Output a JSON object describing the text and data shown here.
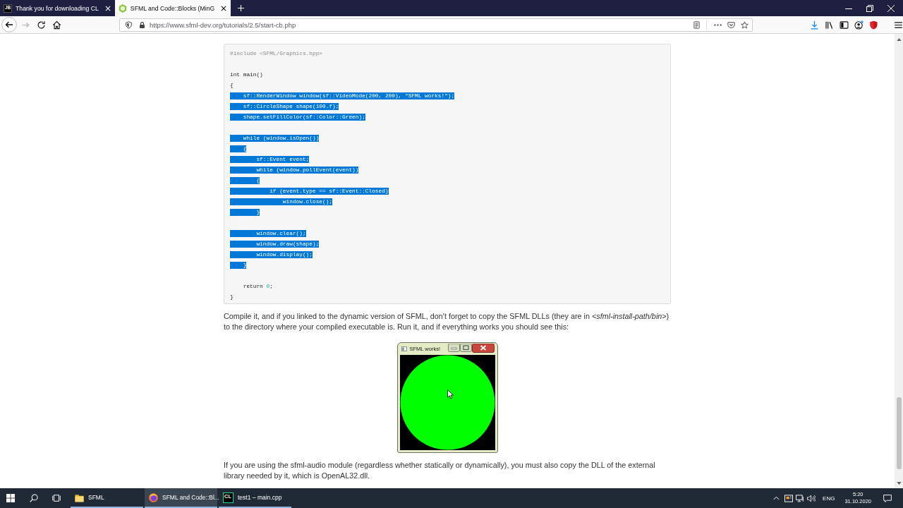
{
  "browser": {
    "tabs": [
      {
        "kind": "letter-logo",
        "icon_text": "JB",
        "title": "Thank you for downloading CL",
        "selected": false
      },
      {
        "kind": "sfml-logo",
        "title": "SFML and Code::Blocks (MinG",
        "selected": true
      }
    ],
    "navigation": {
      "forward_disabled": true
    },
    "url": "https://www.sfml-dev.org/tutorials/2.5/start-cb.php"
  },
  "page": {
    "blocks": [
      {
        "kind": "code",
        "lines": [
          {
            "kind": "directive",
            "text": "#include <SFML/Graphics.hpp>",
            "selected": false
          },
          {
            "kind": "blank"
          },
          {
            "kind": "code",
            "text": "int main()",
            "selected": false
          },
          {
            "kind": "code",
            "text": "{",
            "selected": false
          },
          {
            "kind": "code",
            "text": "    sf::RenderWindow window(sf::VideoMode(200, 200), \"SFML works!\");",
            "selected": true
          },
          {
            "kind": "code",
            "text": "    sf::CircleShape shape(100.f);",
            "selected": true
          },
          {
            "kind": "code",
            "text": "    shape.setFillColor(sf::Color::Green);",
            "selected": true
          },
          {
            "kind": "blank"
          },
          {
            "kind": "code",
            "text": "    while (window.isOpen())",
            "selected": true
          },
          {
            "kind": "code",
            "text": "    {",
            "selected": true
          },
          {
            "kind": "code",
            "text": "        sf::Event event;",
            "selected": true
          },
          {
            "kind": "code",
            "text": "        while (window.pollEvent(event))",
            "selected": true
          },
          {
            "kind": "code",
            "text": "        {",
            "selected": true
          },
          {
            "kind": "code",
            "text": "            if (event.type == sf::Event::Closed)",
            "selected": true
          },
          {
            "kind": "code",
            "text": "                window.close();",
            "selected": true
          },
          {
            "kind": "code",
            "text": "        }",
            "selected": true
          },
          {
            "kind": "blank"
          },
          {
            "kind": "code",
            "text": "        window.clear();",
            "selected": true
          },
          {
            "kind": "code",
            "text": "        window.draw(shape);",
            "selected": true
          },
          {
            "kind": "code",
            "text": "        window.display();",
            "selected": true
          },
          {
            "kind": "code",
            "text": "    }",
            "selected": true
          },
          {
            "kind": "blank"
          },
          {
            "kind": "code",
            "selected": false,
            "segments": [
              {
                "kind": "plain",
                "text": "    return "
              },
              {
                "kind": "number",
                "text": "0"
              },
              {
                "kind": "plain",
                "text": ";"
              }
            ]
          },
          {
            "kind": "code",
            "text": "}",
            "selected": false
          }
        ]
      },
      {
        "kind": "paragraph",
        "text": "Compile it, and if you linked to the dynamic version of SFML, don't forget to copy the SFML DLLs (they are in *<sfml-install-path/bin>*) to the directory where your compiled executable is. Run it, and if everything works you should see this:"
      },
      {
        "kind": "figure",
        "window_title": "SFML works!"
      },
      {
        "kind": "paragraph",
        "text": "If you are using the sfml-audio module (regardless whether statically or dynamically), you must also copy the DLL of the external library needed by it, which is OpenAL32.dll."
      }
    ]
  },
  "taskbar": {
    "items": [
      {
        "kind": "folder",
        "label": "SFML",
        "selected": false
      },
      {
        "kind": "browser",
        "label": "SFML and Code::Bl...",
        "selected": true
      },
      {
        "kind": "ide",
        "icon_text": "CL",
        "label": "test1 – main.cpp",
        "selected": false
      }
    ],
    "tray": {
      "language": "ENG",
      "time": "5:20",
      "date": "31.10.2020"
    }
  }
}
